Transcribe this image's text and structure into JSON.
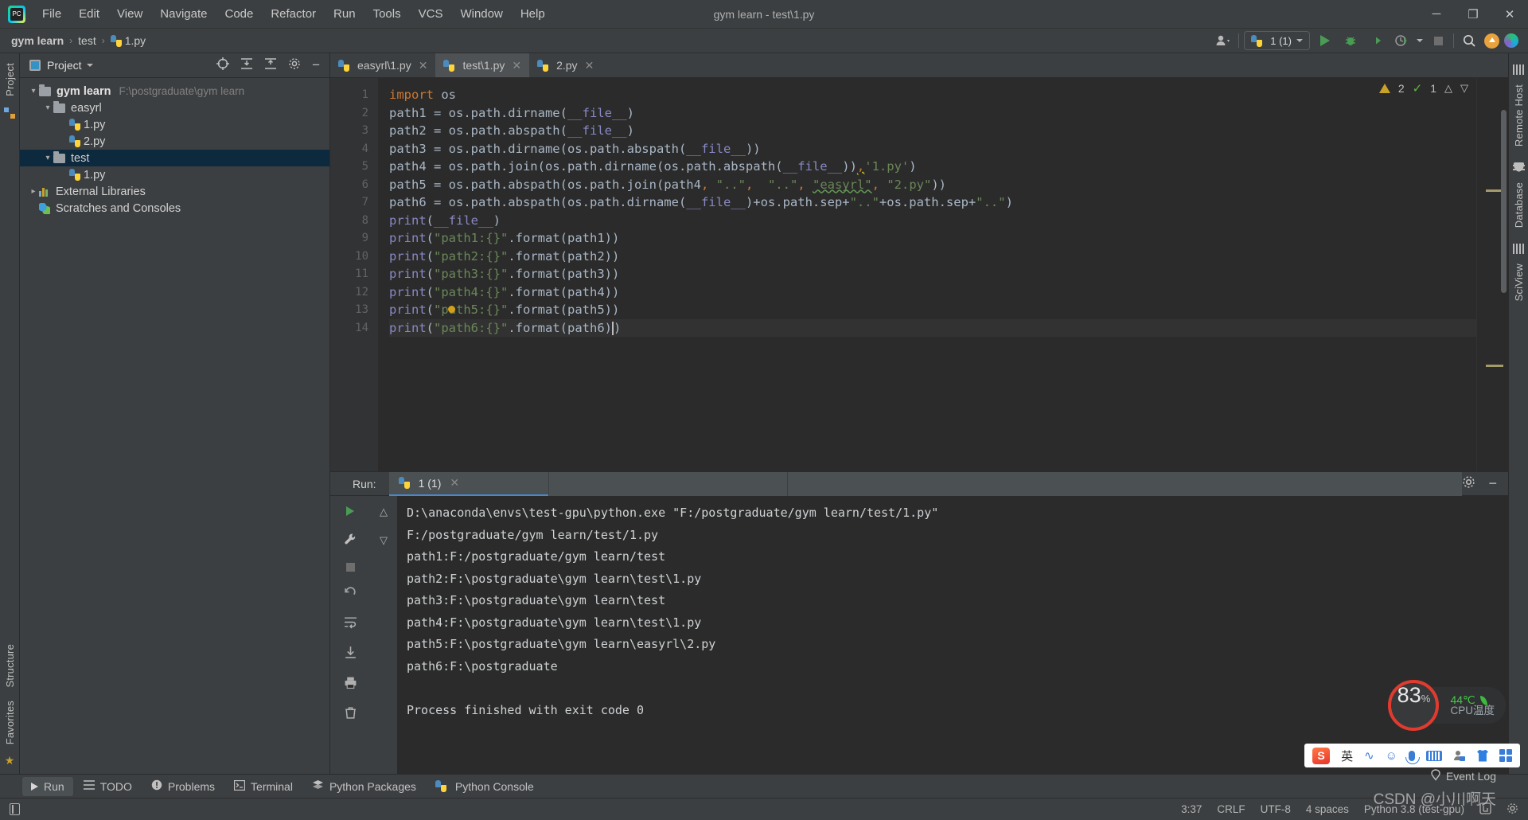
{
  "window": {
    "title": "gym learn - test\\1.py",
    "minimize": "─",
    "maximize": "❐",
    "close": "✕"
  },
  "menubar": {
    "items": [
      "File",
      "Edit",
      "View",
      "Navigate",
      "Code",
      "Refactor",
      "Run",
      "Tools",
      "VCS",
      "Window",
      "Help"
    ]
  },
  "breadcrumb": {
    "project": "gym learn",
    "folder": "test",
    "file": "1.py",
    "separator": "›"
  },
  "toolbar": {
    "run_config": "1 (1)",
    "run_config_label": "1",
    "run_config_count": "(1)",
    "buttons": [
      "run",
      "debug",
      "coverage",
      "profile",
      "stop",
      "search",
      "update",
      "ai"
    ]
  },
  "project_panel": {
    "title": "Project",
    "tree": [
      {
        "label": "gym learn",
        "path": "F:\\postgraduate\\gym learn",
        "type": "module",
        "depth": 0,
        "expanded": true,
        "selected": false
      },
      {
        "label": "easyrl",
        "path": "",
        "type": "folder",
        "depth": 1,
        "expanded": true,
        "selected": false
      },
      {
        "label": "1.py",
        "path": "",
        "type": "python",
        "depth": 2,
        "expanded": null,
        "selected": false
      },
      {
        "label": "2.py",
        "path": "",
        "type": "python",
        "depth": 2,
        "expanded": null,
        "selected": false
      },
      {
        "label": "test",
        "path": "",
        "type": "folder",
        "depth": 1,
        "expanded": true,
        "selected": true
      },
      {
        "label": "1.py",
        "path": "",
        "type": "python",
        "depth": 2,
        "expanded": null,
        "selected": false
      },
      {
        "label": "External Libraries",
        "path": "",
        "type": "library",
        "depth": 0,
        "expanded": false,
        "selected": false
      },
      {
        "label": "Scratches and Consoles",
        "path": "",
        "type": "scratch",
        "depth": 0,
        "expanded": null,
        "selected": false
      }
    ]
  },
  "editor": {
    "tabs": [
      {
        "label": "easyrl\\1.py",
        "active": false
      },
      {
        "label": "test\\1.py",
        "active": true
      },
      {
        "label": "2.py",
        "active": false
      }
    ],
    "close_glyph": "✕",
    "inspection": {
      "warnings": "2",
      "typos": "1",
      "up": "⌃",
      "down": "⌄"
    },
    "line_numbers": [
      "1",
      "2",
      "3",
      "4",
      "5",
      "6",
      "7",
      "8",
      "9",
      "10",
      "11",
      "12",
      "13",
      "14"
    ],
    "code_lines": [
      "import os",
      "path1 = os.path.dirname(__file__)",
      "path2 = os.path.abspath(__file__)",
      "path3 = os.path.dirname(os.path.abspath(__file__))",
      "path4 = os.path.join(os.path.dirname(os.path.abspath(__file__)),'1.py')",
      "path5 = os.path.abspath(os.path.join(path4, \"..\",  \"..\", \"easyrl\", \"2.py\"))",
      "path6 = os.path.abspath(os.path.dirname(__file__)+os.path.sep+\"..\"+os.path.sep+\"..\")",
      "print(__file__)",
      "print(\"path1:{}\".format(path1))",
      "print(\"path2:{}\".format(path2))",
      "print(\"path3:{}\".format(path3))",
      "print(\"path4:{}\".format(path4))",
      "print(\"path5:{}\".format(path5))",
      "print(\"path6:{}\".format(path6))"
    ]
  },
  "run_window": {
    "label": "Run:",
    "tab": "1 (1)",
    "close_glyph": "✕",
    "console_lines": [
      "D:\\anaconda\\envs\\test-gpu\\python.exe \"F:/postgraduate/gym learn/test/1.py\"",
      "F:/postgraduate/gym learn/test/1.py",
      "path1:F:/postgraduate/gym learn/test",
      "path2:F:\\postgraduate\\gym learn\\test\\1.py",
      "path3:F:\\postgraduate\\gym learn\\test",
      "path4:F:\\postgraduate\\gym learn\\test\\1.py",
      "path5:F:\\postgraduate\\gym learn\\easyrl\\2.py",
      "path6:F:\\postgraduate",
      "",
      "Process finished with exit code 0"
    ]
  },
  "tool_strip": {
    "items": [
      {
        "label": "Run",
        "icon": "run-icon",
        "active": true
      },
      {
        "label": "TODO",
        "icon": "todo-icon",
        "active": false
      },
      {
        "label": "Problems",
        "icon": "problems-icon",
        "active": false
      },
      {
        "label": "Terminal",
        "icon": "terminal-icon",
        "active": false
      },
      {
        "label": "Python Packages",
        "icon": "packages-icon",
        "active": false
      },
      {
        "label": "Python Console",
        "icon": "python-console-icon",
        "active": false
      }
    ]
  },
  "status_bar": {
    "event_log": "Event Log",
    "caret_position": "3:37",
    "line_separator": "CRLF",
    "encoding": "UTF-8",
    "indent": "4 spaces",
    "interpreter": "Python 3.8 (test-gpu)"
  },
  "left_strip": {
    "labels": [
      "Project",
      "Structure",
      "Favorites"
    ]
  },
  "right_strip": {
    "labels": [
      "Remote Host",
      "Database",
      "SciView"
    ]
  },
  "cpu_widget": {
    "percent": "83",
    "percent_symbol": "%",
    "temperature": "44℃",
    "caption": "CPU温度",
    "ring_color": "#e03b2f",
    "temp_color": "#49c84a"
  },
  "ime_bar": {
    "language": "英",
    "items": [
      "sogou-logo",
      "english-mode",
      "voice-icon",
      "emoji-icon",
      "mic-icon",
      "keyboard-icon",
      "user-icon",
      "skin-icon",
      "apps-icon"
    ]
  },
  "watermark": {
    "text": "CSDN @小川啊天"
  },
  "colors": {
    "background": "#3c3f41",
    "editor_bg": "#2b2b2b",
    "accent_blue": "#4a88c7",
    "selection": "#0d293e",
    "keyword": "#cc7832",
    "string": "#6a8759",
    "number": "#6897bb",
    "builtin": "#8888c6",
    "text": "#a9b7c6"
  }
}
